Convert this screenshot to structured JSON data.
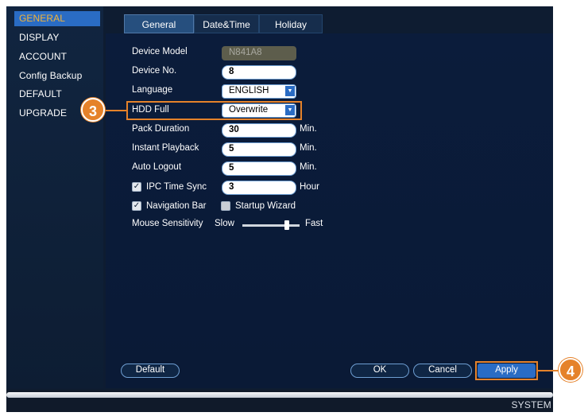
{
  "sidebar": {
    "items": [
      {
        "label": "GENERAL",
        "active": true
      },
      {
        "label": "DISPLAY"
      },
      {
        "label": "ACCOUNT"
      },
      {
        "label": "Config Backup"
      },
      {
        "label": "DEFAULT"
      },
      {
        "label": "UPGRADE"
      }
    ]
  },
  "tabs": [
    {
      "label": "General",
      "active": true
    },
    {
      "label": "Date&Time"
    },
    {
      "label": "Holiday"
    }
  ],
  "form": {
    "device_model": {
      "label": "Device Model",
      "value": "N841A8"
    },
    "device_no": {
      "label": "Device No.",
      "value": "8"
    },
    "language": {
      "label": "Language",
      "value": "ENGLISH"
    },
    "hdd_full": {
      "label": "HDD Full",
      "value": "Overwrite"
    },
    "pack_duration": {
      "label": "Pack Duration",
      "value": "30",
      "unit": "Min."
    },
    "instant_playback": {
      "label": "Instant Playback",
      "value": "5",
      "unit": "Min."
    },
    "auto_logout": {
      "label": "Auto Logout",
      "value": "5",
      "unit": "Min."
    },
    "ipc_time_sync": {
      "label": "IPC Time Sync",
      "checked": true,
      "value": "3",
      "unit": "Hour"
    },
    "navigation_bar": {
      "label": "Navigation Bar",
      "checked": true
    },
    "startup_wizard": {
      "label": "Startup Wizard",
      "checked": false
    },
    "mouse_sensitivity": {
      "label": "Mouse Sensitivity",
      "slow_label": "Slow",
      "fast_label": "Fast"
    }
  },
  "buttons": {
    "default": "Default",
    "ok": "OK",
    "cancel": "Cancel",
    "apply": "Apply"
  },
  "callouts": {
    "hdd_full": "3",
    "apply": "4"
  },
  "footer": {
    "label": "SYSTEM"
  },
  "colors": {
    "accent": "#2a6cc4",
    "highlight": "#e5822a",
    "selected_text": "#f2b33a",
    "background": "#0e1c31"
  }
}
